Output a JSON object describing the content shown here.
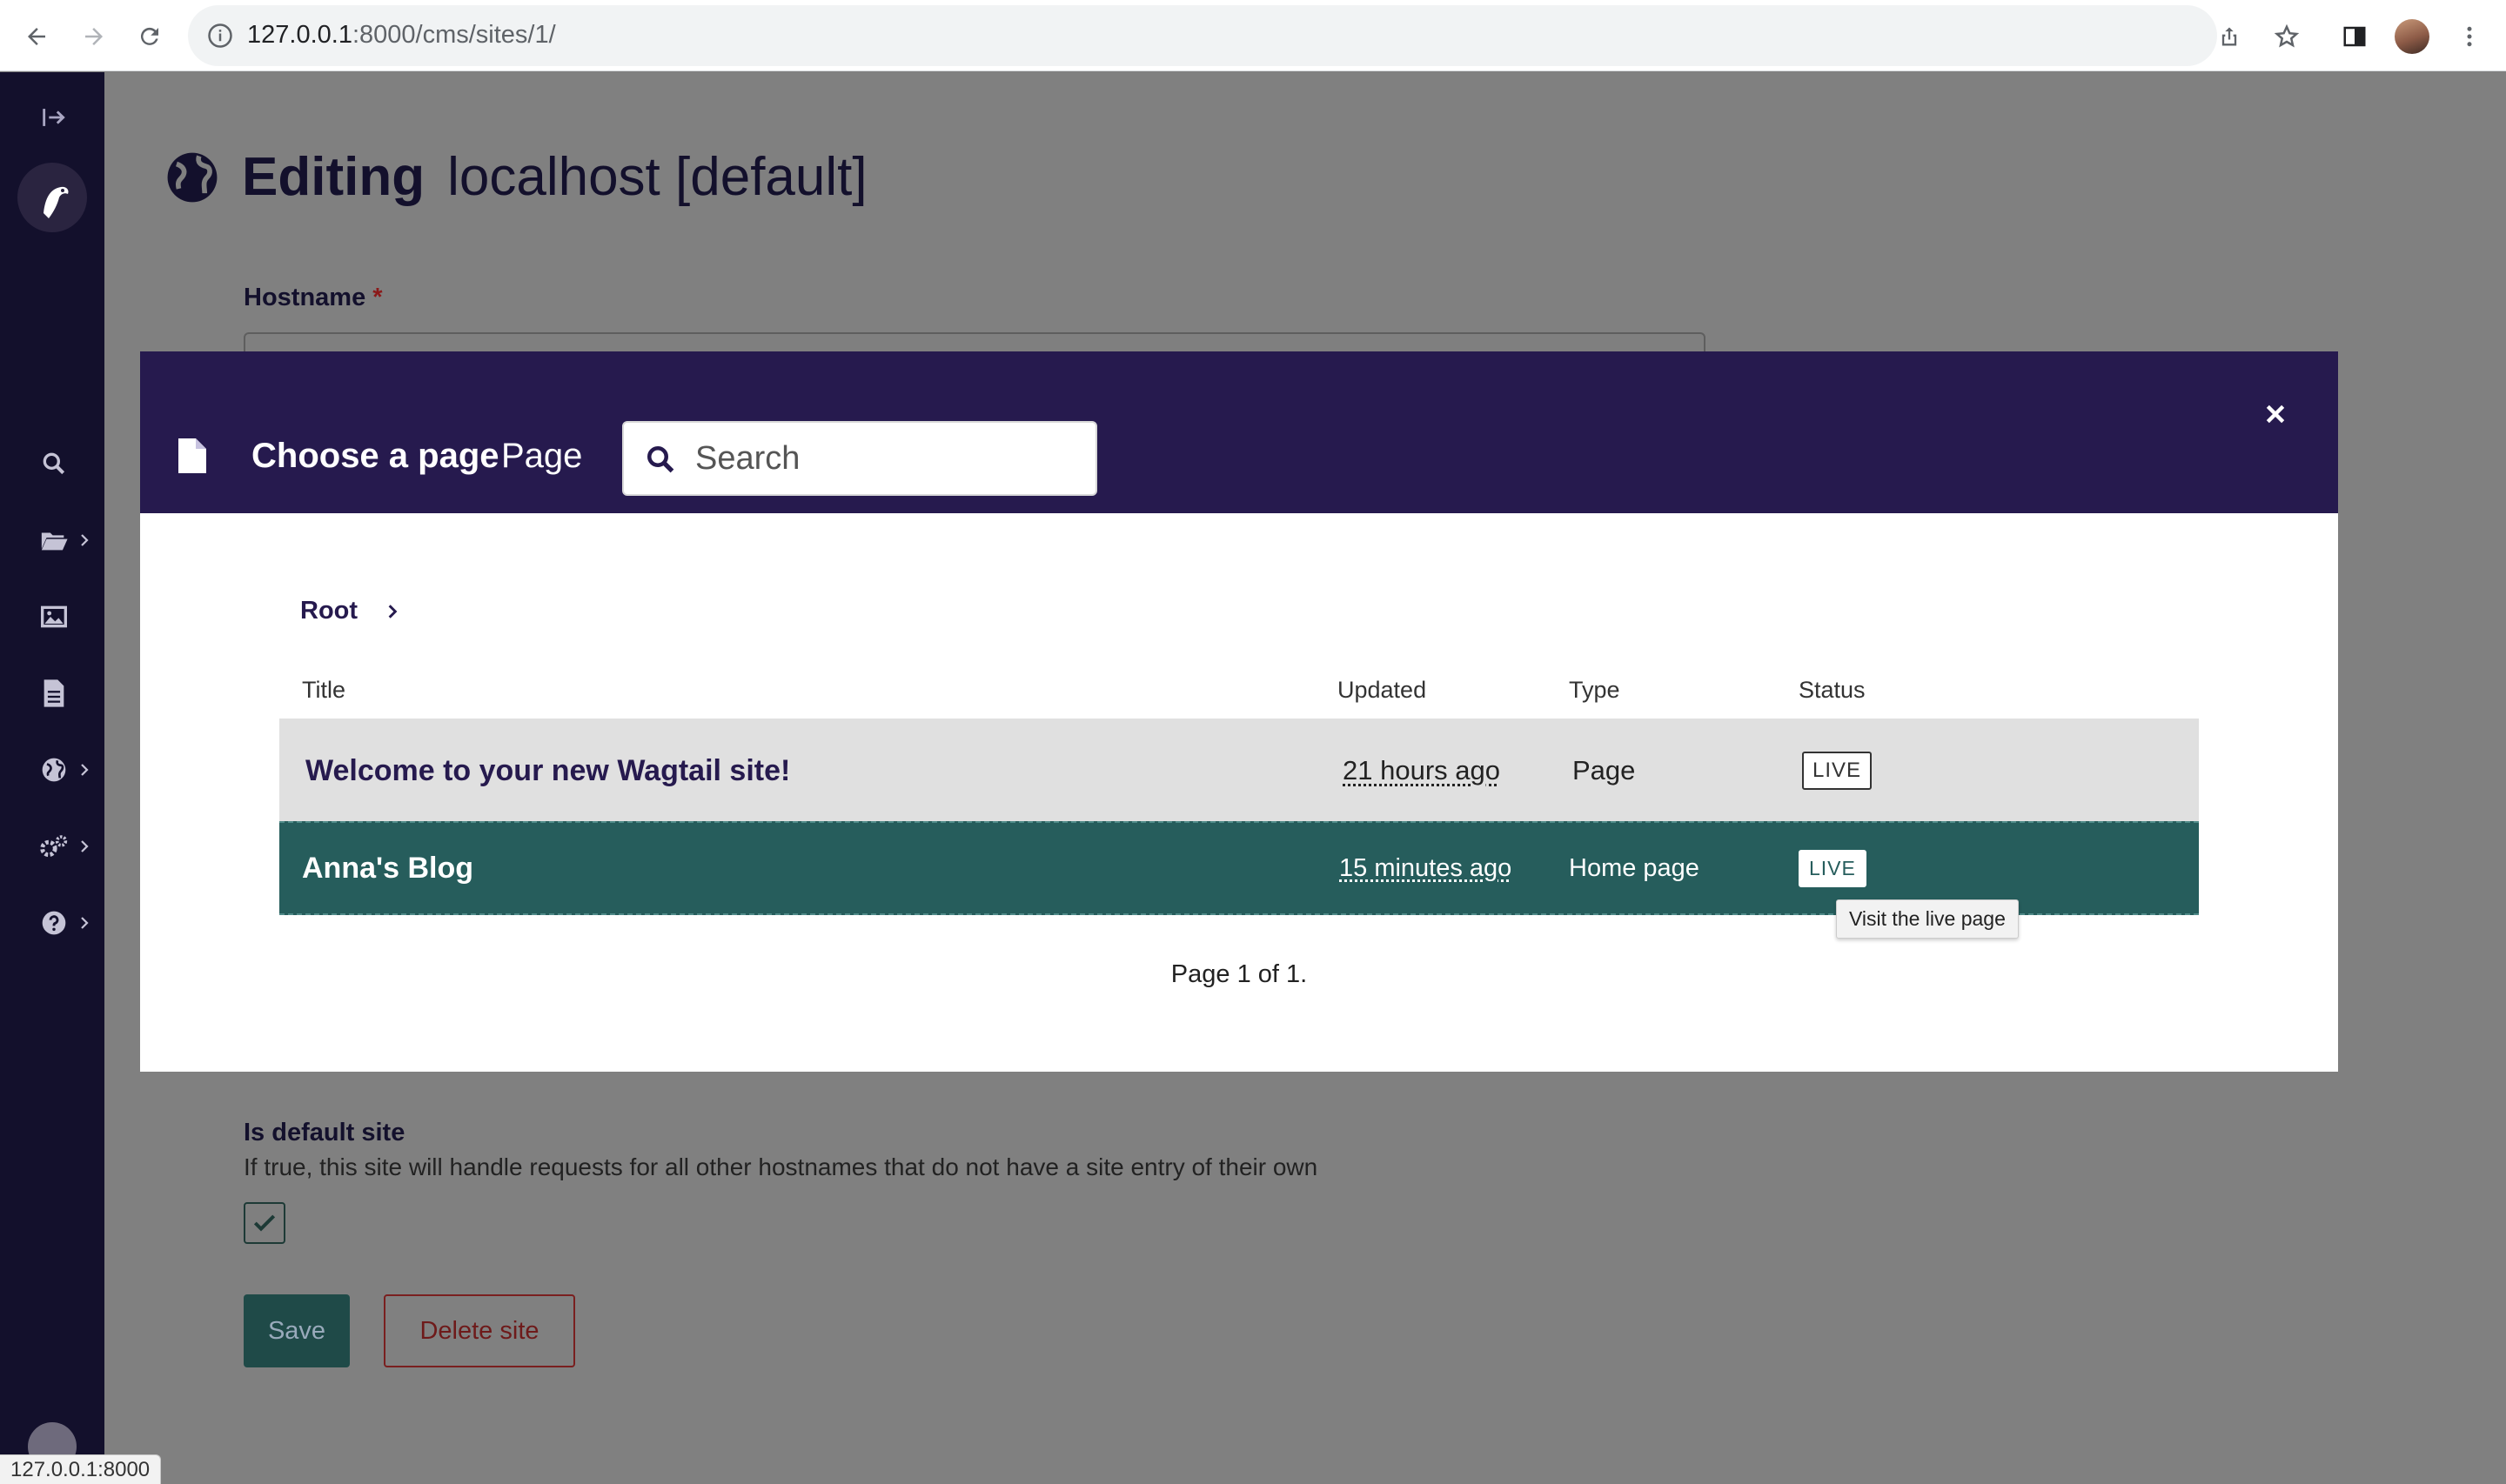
{
  "browser": {
    "url_host": "127.0.0.1",
    "url_rest": ":8000/cms/sites/1/",
    "status_url": "127.0.0.1:8000"
  },
  "page": {
    "title": "Editing",
    "subtitle": "localhost [default]",
    "hostname_label": "Hostname",
    "required_marker": "*",
    "default_site_label": "Is default site",
    "default_site_help": "If true, this site will handle requests for all other hostnames that do not have a site entry of their own",
    "default_site_checked": true,
    "save_label": "Save",
    "delete_label": "Delete site"
  },
  "sidebar": {
    "items": [
      {
        "icon": "expand-sidebar-icon"
      },
      {
        "icon": "search-icon"
      },
      {
        "icon": "folder-open-icon"
      },
      {
        "icon": "image-icon"
      },
      {
        "icon": "document-icon"
      },
      {
        "icon": "globe-icon"
      },
      {
        "icon": "cogs-icon"
      },
      {
        "icon": "help-icon"
      }
    ]
  },
  "modal": {
    "title": "Choose a page",
    "subtitle": "Page",
    "search_placeholder": "Search",
    "breadcrumb_root": "Root",
    "columns": {
      "title": "Title",
      "updated": "Updated",
      "type": "Type",
      "status": "Status"
    },
    "rows": [
      {
        "title": "Welcome to your new Wagtail site!",
        "updated": "21 hours ago",
        "type": "Page",
        "status": "LIVE"
      },
      {
        "title": "Anna's Blog",
        "updated": "15 minutes ago",
        "type": "Home page",
        "status": "LIVE"
      }
    ],
    "tooltip": "Visit the live page",
    "pagination": "Page 1 of 1."
  },
  "colors": {
    "sidebar": "#13102c",
    "modal_header": "#261a4e",
    "selected_row": "#265d5c",
    "overlay": "#808080"
  }
}
